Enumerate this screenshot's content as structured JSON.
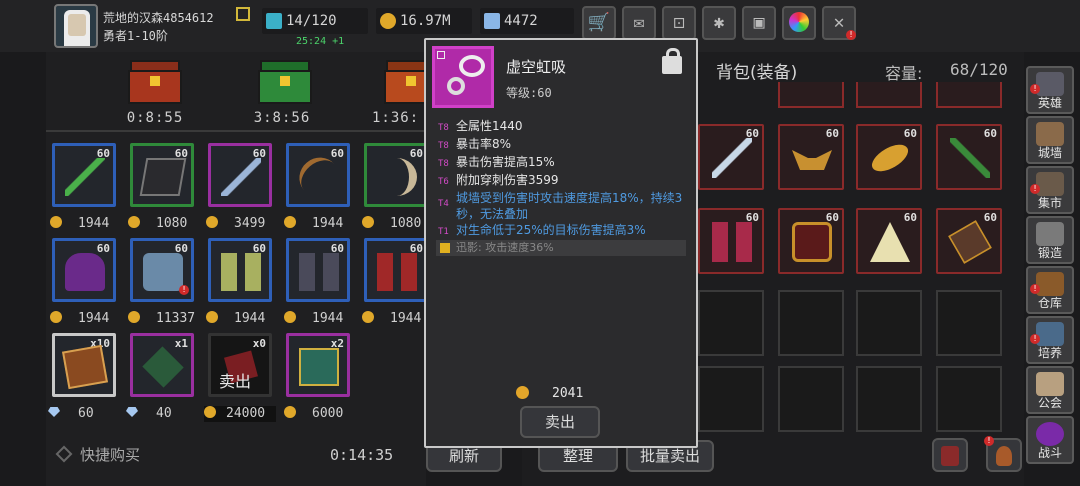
{
  "player": {
    "name": "荒地的汉森4854612",
    "rank": "勇者1-10阶"
  },
  "resources": {
    "energy": "14/120",
    "energy_timer": "25:24 +1",
    "gold": "16.97M",
    "gems": "4472"
  },
  "top_icons": [
    "shop-cart-icon",
    "mail-icon",
    "gamepad-icon",
    "settings-gear-icon",
    "gift-icon",
    "color-wheel-icon",
    "broom-icon"
  ],
  "chests": [
    {
      "timer": "0:8:55",
      "color": "#a8361e"
    },
    {
      "timer": "3:8:56",
      "color": "#2e8a3a"
    },
    {
      "timer": "1:36:",
      "color": "#b84a1e"
    }
  ],
  "shop_rows": [
    [
      {
        "level": "60",
        "price": "1944",
        "border": "#2e5fb8"
      },
      {
        "level": "60",
        "price": "1080",
        "border": "#2f8a3a"
      },
      {
        "level": "60",
        "price": "3499",
        "border": "#9a2fa0"
      },
      {
        "level": "60",
        "price": "1944",
        "border": "#2e5fb8"
      },
      {
        "level": "60",
        "price": "1080",
        "border": "#2f8a3a"
      }
    ],
    [
      {
        "level": "60",
        "price": "1944",
        "border": "#2e5fb8"
      },
      {
        "level": "60",
        "price": "11337",
        "border": "#2e5fb8"
      },
      {
        "level": "60",
        "price": "1944",
        "border": "#2e5fb8"
      },
      {
        "level": "60",
        "price": "1944",
        "border": "#2e5fb8"
      },
      {
        "level": "60",
        "price": "1944",
        "border": "#2e5fb8"
      }
    ],
    [
      {
        "count": "x10",
        "price": "60",
        "currency": "gem",
        "border": "#c8c8c8"
      },
      {
        "count": "x1",
        "price": "40",
        "currency": "gem",
        "border": "#9a2fa0"
      },
      {
        "count": "x0",
        "price": "24000",
        "currency": "coin",
        "border": "#333333",
        "sold": "卖出"
      },
      {
        "count": "x2",
        "price": "6000",
        "currency": "coin",
        "border": "#9a2fa0"
      }
    ]
  ],
  "quick_buy": "快捷购买",
  "shop_timer": "0:14:35",
  "refresh_label": "刷新",
  "bag": {
    "title": "背包(装备)",
    "capacity_label": "容量:",
    "capacity_value": "68/120",
    "items": [
      {
        "level": "60"
      },
      {
        "level": "60"
      },
      {
        "level": "60"
      },
      {
        "level": "60"
      },
      {
        "level": "60"
      },
      {
        "level": "60"
      },
      {
        "level": "60"
      },
      {
        "level": "60"
      }
    ],
    "sort_label": "整理",
    "bulk_sell_label": "批量卖出"
  },
  "side_menu": [
    {
      "label": "英雄"
    },
    {
      "label": "城墙"
    },
    {
      "label": "集市"
    },
    {
      "label": "锻造"
    },
    {
      "label": "仓库"
    },
    {
      "label": "培养"
    },
    {
      "label": "公会"
    },
    {
      "label": "战斗"
    }
  ],
  "tooltip": {
    "name": "虚空虹吸",
    "level": "等级:60",
    "stats": [
      {
        "tier": "T8",
        "text": "全属性1440"
      },
      {
        "tier": "T8",
        "text": "暴击率8%"
      },
      {
        "tier": "T8",
        "text": "暴击伤害提高15%"
      },
      {
        "tier": "T6",
        "text": "附加穿刺伤害3599"
      },
      {
        "tier": "T4",
        "text": "城墙受到伤害时攻击速度提高18%，持续3秒，无法叠加"
      },
      {
        "tier": "T1",
        "text": "对生命低于25%的目标伤害提高3%"
      }
    ],
    "shadow": "迅影: 攻击速度36%",
    "price": "2041",
    "sell_label": "卖出"
  }
}
